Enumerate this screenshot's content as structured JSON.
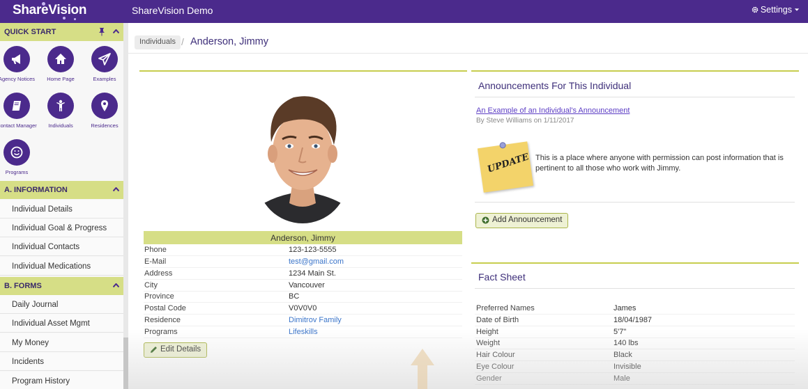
{
  "topbar": {
    "logo": "ShareVision",
    "app_title": "ShareVision Demo",
    "settings_label": "Settings"
  },
  "sidebar": {
    "quick_start": {
      "title": "QUICK START",
      "items": [
        {
          "label": "Agency Notices",
          "icon": "megaphone-icon"
        },
        {
          "label": "Home Page",
          "icon": "home-icon"
        },
        {
          "label": "Examples",
          "icon": "paper-plane-icon"
        },
        {
          "label": "Contact Manager",
          "icon": "book-icon"
        },
        {
          "label": "Individuals",
          "icon": "person-icon"
        },
        {
          "label": "Residences",
          "icon": "map-marker-icon"
        },
        {
          "label": "Programs",
          "icon": "smiley-icon"
        }
      ]
    },
    "information": {
      "title": "A. INFORMATION",
      "items": [
        "Individual Details",
        "Individual Goal & Progress",
        "Individual Contacts",
        "Individual Medications"
      ]
    },
    "forms": {
      "title": "B. FORMS",
      "items": [
        "Daily Journal",
        "Individual Asset Mgmt",
        "My Money",
        "Incidents",
        "Program History"
      ]
    }
  },
  "breadcrumb": {
    "parent": "Individuals",
    "separator": "/",
    "current": "Anderson, Jimmy"
  },
  "profile": {
    "name": "Anderson, Jimmy",
    "rows": [
      {
        "label": "Phone",
        "value": "123-123-5555",
        "link": false
      },
      {
        "label": "E-Mail",
        "value": "test@gmail.com",
        "link": true
      },
      {
        "label": "Address",
        "value": "1234 Main St.",
        "link": false
      },
      {
        "label": "City",
        "value": "Vancouver",
        "link": false
      },
      {
        "label": "Province",
        "value": "BC",
        "link": false
      },
      {
        "label": "Postal Code",
        "value": "V0V0V0",
        "link": false
      },
      {
        "label": "Residence",
        "value": "Dimitrov Family",
        "link": true
      },
      {
        "label": "Programs",
        "value": "Lifeskills",
        "link": true
      }
    ],
    "edit_button": "Edit Details"
  },
  "announcements": {
    "title": "Announcements For This Individual",
    "link_text": "An Example of an Individual's Announcement",
    "meta": "By Steve Williams on 1/11/2017",
    "note_text": "UPDATE",
    "body": "This is a place where anyone with permission can post information that is pertinent to all those who work with Jimmy.",
    "add_button": "Add Announcement"
  },
  "fact_sheet": {
    "title": "Fact Sheet",
    "rows": [
      {
        "label": "Preferred Names",
        "value": "James"
      },
      {
        "label": "Date of Birth",
        "value": "18/04/1987"
      },
      {
        "label": "Height",
        "value": "5'7\""
      },
      {
        "label": "Weight",
        "value": "140 lbs"
      },
      {
        "label": "Hair Colour",
        "value": "Black"
      },
      {
        "label": "Eye Colour",
        "value": "Invisible"
      },
      {
        "label": "Gender",
        "value": "Male"
      }
    ]
  },
  "colors": {
    "brand": "#4b2a8c",
    "accent": "#d6de86",
    "link": "#3a74c9"
  }
}
